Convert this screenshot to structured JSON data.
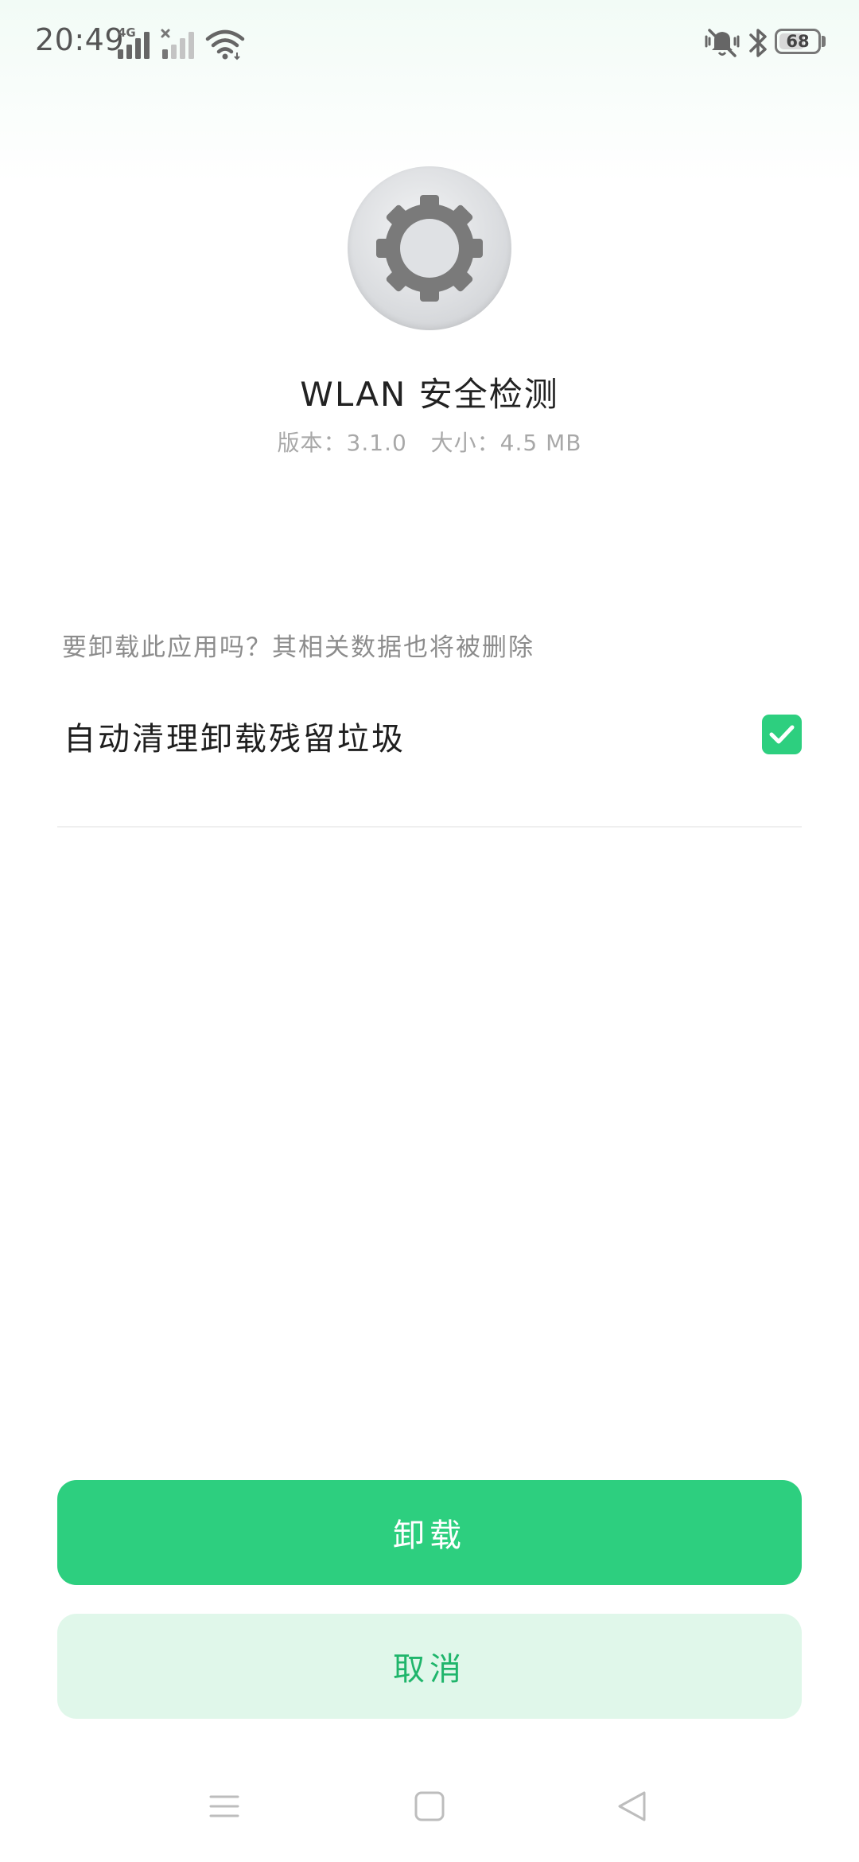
{
  "status_bar": {
    "time": "20:49",
    "network_label": "4G",
    "battery": "68",
    "battery_level": 0.68,
    "icons": [
      "signal-icon",
      "signal-no-service-icon",
      "wifi-icon",
      "mute-vibrate-icon",
      "bluetooth-icon",
      "battery-icon"
    ]
  },
  "app": {
    "icon": "gear-icon",
    "name": "WLAN 安全检测",
    "version": "版本：3.1.0",
    "size": "大小：4.5 MB"
  },
  "dialog": {
    "question": "要卸载此应用吗？其相关数据也将被删除",
    "option_label": "自动清理卸载残留垃圾",
    "option_checked": true
  },
  "buttons": {
    "uninstall": "卸载",
    "cancel": "取消"
  },
  "nav_bar": {
    "icons": [
      "menu-icon",
      "home-icon",
      "back-icon"
    ]
  },
  "colors": {
    "accent": "#2dcf7f",
    "cancel_bg": "#e0f7ea",
    "cancel_text": "#1fb56b"
  }
}
